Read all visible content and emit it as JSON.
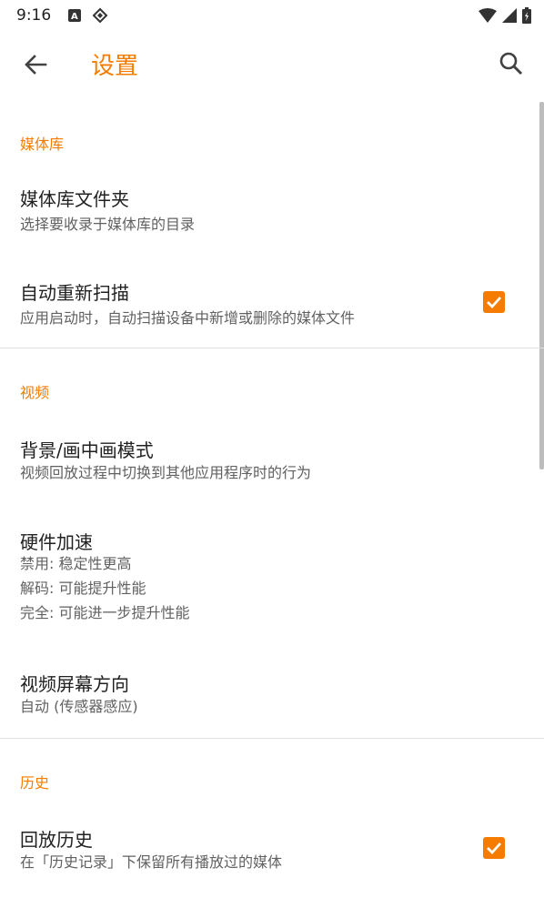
{
  "status_bar": {
    "time": "9:16",
    "icons": [
      "a-notification-icon",
      "tag-notification-icon",
      "wifi-icon",
      "signal-icon",
      "battery-icon"
    ]
  },
  "toolbar": {
    "title": "设置",
    "back_icon": "arrow-back-icon",
    "search_icon": "search-icon"
  },
  "colors": {
    "accent": "#f57c00",
    "text_primary": "#212121",
    "text_secondary": "#616161",
    "divider": "#e0e0e0"
  },
  "sections": [
    {
      "header": "媒体库",
      "items": [
        {
          "title": "媒体库文件夹",
          "summary": [
            "选择要收录于媒体库的目录"
          ]
        },
        {
          "title": "自动重新扫描",
          "summary": [
            "应用启动时，自动扫描设备中新增或删除的媒体文件"
          ],
          "checked": true
        }
      ]
    },
    {
      "header": "视频",
      "items": [
        {
          "title": "背景/画中画模式",
          "summary": [
            "视频回放过程中切换到其他应用程序时的行为"
          ]
        },
        {
          "title": "硬件加速",
          "summary": [
            "禁用: 稳定性更高",
            "解码: 可能提升性能",
            "完全: 可能进一步提升性能"
          ]
        },
        {
          "title": "视频屏幕方向",
          "summary": [
            "自动 (传感器感应)"
          ]
        }
      ]
    },
    {
      "header": "历史",
      "items": [
        {
          "title": "回放历史",
          "summary": [
            "在「历史记录」下保留所有播放过的媒体"
          ],
          "checked": true
        }
      ]
    }
  ]
}
